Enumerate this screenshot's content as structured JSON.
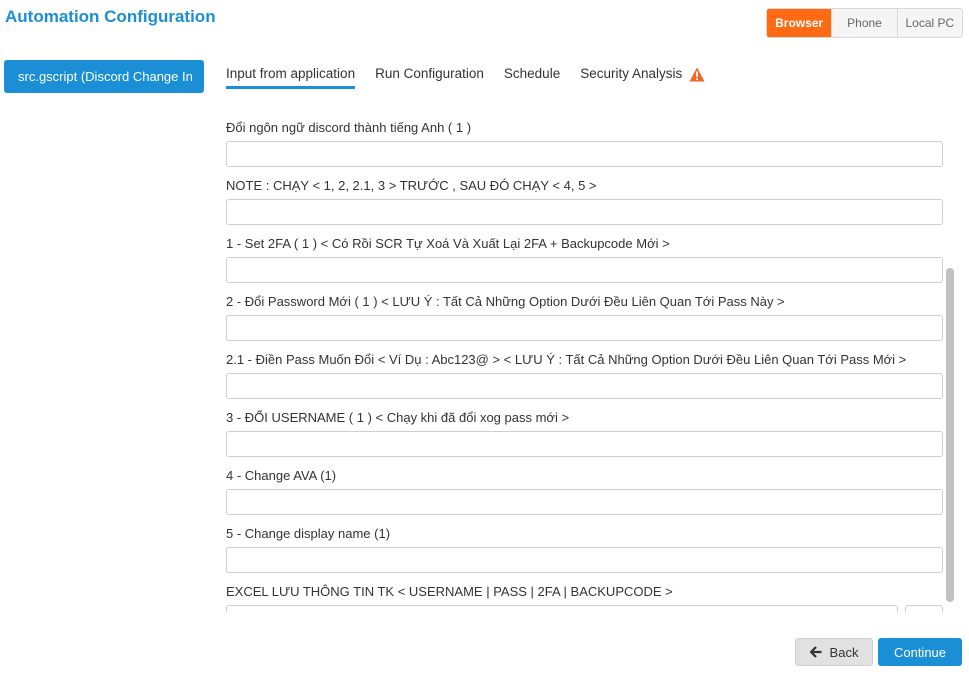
{
  "header": {
    "title": "Automation Configuration"
  },
  "env_toggle": {
    "options": [
      "Browser",
      "Phone",
      "Local PC"
    ],
    "selected": "Browser"
  },
  "sidebar": {
    "script_label": "src.gscript   (Discord Change In"
  },
  "tabs": [
    {
      "label": "Input from application",
      "active": true
    },
    {
      "label": "Run Configuration",
      "active": false
    },
    {
      "label": "Schedule",
      "active": false
    },
    {
      "label": "Security Analysis",
      "active": false,
      "icon": "warning-icon"
    }
  ],
  "fields": [
    {
      "label": "Đổi ngôn ngữ discord thành tiếng Anh ( 1 )",
      "value": ""
    },
    {
      "label": "NOTE : CHẠY < 1, 2, 2.1, 3 > TRƯỚC , SAU ĐÓ CHẠY < 4, 5 >",
      "value": ""
    },
    {
      "label": "1 - Set 2FA ( 1 ) < Có Rồi SCR Tự Xoá Và Xuất Lại 2FA + Backupcode Mới >",
      "value": ""
    },
    {
      "label": "2 - Đổi Password Mới ( 1 ) < LƯU Ý : Tất Cả Những Option Dưới Đều Liên Quan Tới Pass Này >",
      "value": ""
    },
    {
      "label": "2.1 - Điền Pass Muốn Đổi < Ví Dụ : Abc123@ > < LƯU Ý : Tất Cả Những Option Dưới Đều Liên Quan Tới Pass Mới >",
      "value": ""
    },
    {
      "label": "3 - ĐỔI USERNAME ( 1 ) < Chạy khi đã đổi xog pass mới >",
      "value": ""
    },
    {
      "label": "4 - Change AVA (1)",
      "value": ""
    },
    {
      "label": "5 - Change display name (1)",
      "value": ""
    },
    {
      "label": "EXCEL LƯU THÔNG TIN TK < USERNAME | PASS | 2FA | BACKUPCODE >",
      "value": ""
    }
  ],
  "footer": {
    "back_label": "Back",
    "continue_label": "Continue"
  },
  "colors": {
    "accent": "#1a8fd6",
    "selected_env": "#ff6a13",
    "warning": "#f26522"
  }
}
